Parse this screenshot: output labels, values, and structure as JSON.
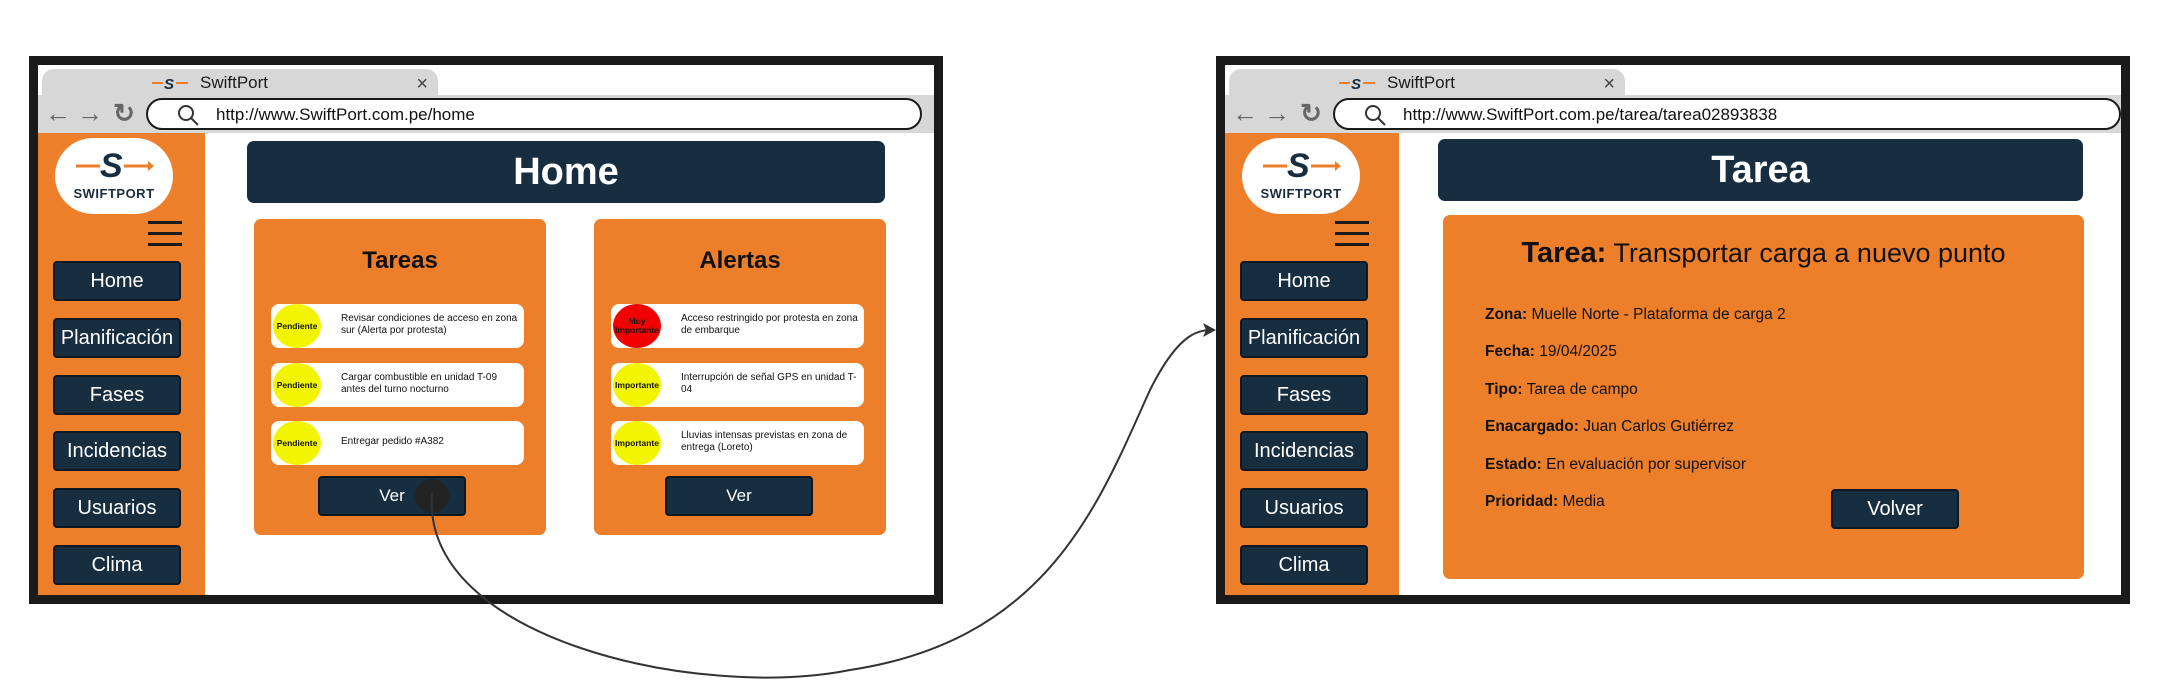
{
  "home": {
    "tab": {
      "title": "SwiftPort",
      "close": "×"
    },
    "nav": {
      "back": "←",
      "forward": "→",
      "reload": "↻",
      "url": "http://www.SwiftPort.com.pe/home"
    },
    "logo": {
      "text": "SWIFTPORT"
    },
    "sidebar": {
      "items": [
        "Home",
        "Planificación",
        "Fases",
        "Incidencias",
        "Usuarios",
        "Clima"
      ]
    },
    "header": "Home",
    "tareas": {
      "title": "Tareas",
      "items": [
        {
          "status": "Pendiente",
          "text": "Revisar condiciones de acceso en zona sur (Alerta por protesta)"
        },
        {
          "status": "Pendiente",
          "text": "Cargar combustible en unidad T-09 antes del turno nocturno"
        },
        {
          "status": "Pendiente",
          "text": "Entregar pedido #A382"
        }
      ],
      "button": "Ver"
    },
    "alertas": {
      "title": "Alertas",
      "items": [
        {
          "status": "Muy Importante",
          "text": "Acceso restringido por protesta en zona de embarque"
        },
        {
          "status": "Importante",
          "text": "Interrupción de señal GPS en unidad T-04"
        },
        {
          "status": "Importante",
          "text": "Lluvias intensas previstas en zona de entrega (Loreto)"
        }
      ],
      "button": "Ver"
    }
  },
  "tarea": {
    "tab": {
      "title": "SwiftPort",
      "close": "×"
    },
    "nav": {
      "back": "←",
      "forward": "→",
      "reload": "↻",
      "url": "http://www.SwiftPort.com.pe/tarea/tarea02893838"
    },
    "logo": {
      "text": "SWIFTPORT"
    },
    "sidebar": {
      "items": [
        "Home",
        "Planificación",
        "Fases",
        "Incidencias",
        "Usuarios",
        "Clima"
      ]
    },
    "header": "Tarea",
    "detail": {
      "title_label": "Tarea:",
      "title_value": "Transportar carga a nuevo punto",
      "fields": [
        {
          "label": "Zona:",
          "value": "Muelle Norte - Plataforma de carga 2"
        },
        {
          "label": "Fecha:",
          "value": "19/04/2025"
        },
        {
          "label": "Tipo:",
          "value": "Tarea de campo"
        },
        {
          "label": "Enacargado:",
          "value": "Juan Carlos Gutiérrez"
        },
        {
          "label": "Estado:",
          "value": "En evaluación por supervisor"
        },
        {
          "label": "Prioridad:",
          "value": "Media"
        }
      ],
      "button": "Volver"
    }
  },
  "colors": {
    "orange": "#ee7f2a",
    "navy": "#172d40",
    "pending_yellow": "#f3f500",
    "urgent_red": "#f00000"
  }
}
